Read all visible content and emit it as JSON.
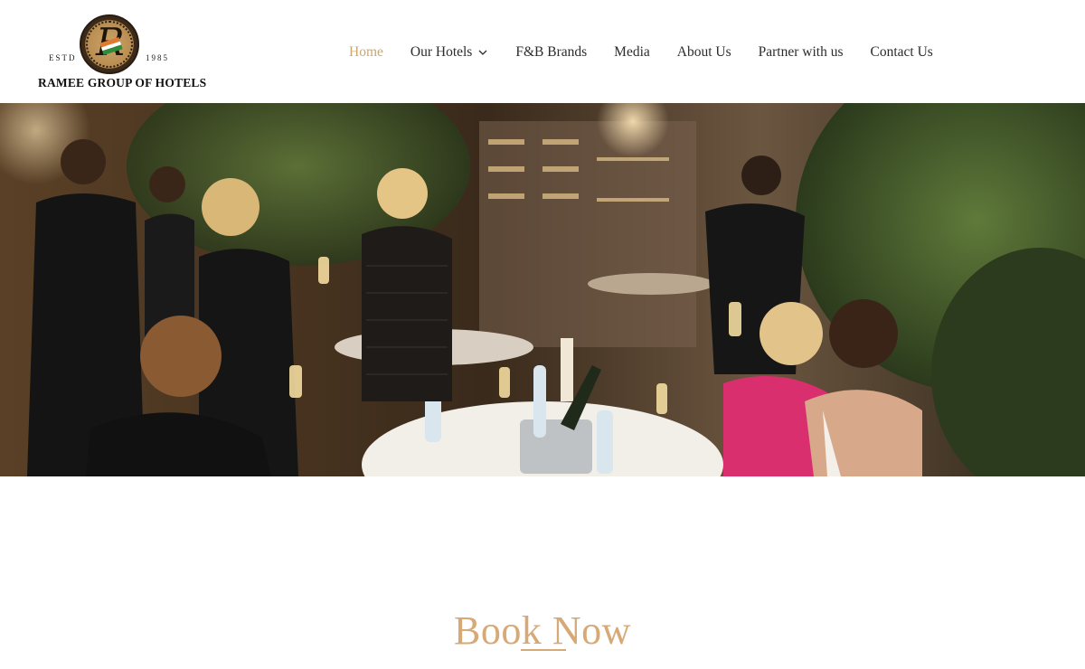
{
  "brand": {
    "name": "RAMEE GROUP OF HOTELS",
    "estd_label": "ESTD",
    "year": "1985",
    "emblem_letter": "R"
  },
  "nav": {
    "items": [
      {
        "label": "Home",
        "active": true
      },
      {
        "label": "Our Hotels",
        "has_dropdown": true
      },
      {
        "label": "F&B Brands"
      },
      {
        "label": "Media"
      },
      {
        "label": "About Us"
      },
      {
        "label": "Partner with us"
      },
      {
        "label": "Contact Us"
      }
    ],
    "dropdown_icon": "chevron-down-icon"
  },
  "hero": {
    "image": "rooftop-restaurant-party-photo"
  },
  "book": {
    "title": "Book Now"
  },
  "colors": {
    "accent": "#c9a76e",
    "book_title": "#d6a977",
    "text": "#2c2c2c"
  }
}
